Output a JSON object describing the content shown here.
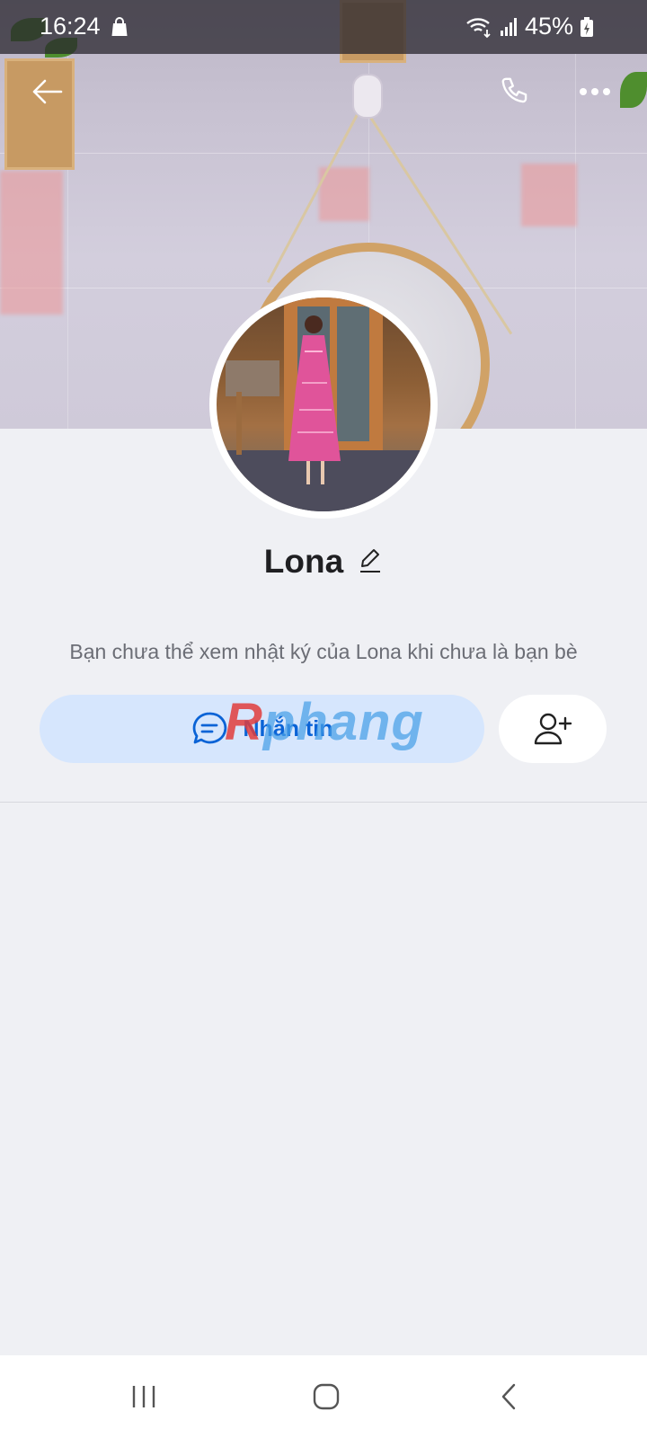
{
  "status_bar": {
    "time": "16:24",
    "battery": "45%"
  },
  "toolbar": {
    "back_icon": "arrow-left-icon",
    "call_icon": "phone-icon",
    "more_icon": "more-horizontal-icon"
  },
  "profile": {
    "name": "Lona",
    "edit_icon": "pencil-icon",
    "privacy_note": "Bạn chưa thể xem nhật ký của Lona khi chưa là bạn bè"
  },
  "actions": {
    "message_label": "Nhắn tin",
    "message_icon": "chat-bubble-icon",
    "add_friend_icon": "add-user-icon"
  },
  "watermark": {
    "prefix": "R",
    "rest": "phang"
  },
  "colors": {
    "accent": "#0a63d6",
    "message_button_bg": "#d6e6fd",
    "page_bg": "#eff0f4"
  }
}
